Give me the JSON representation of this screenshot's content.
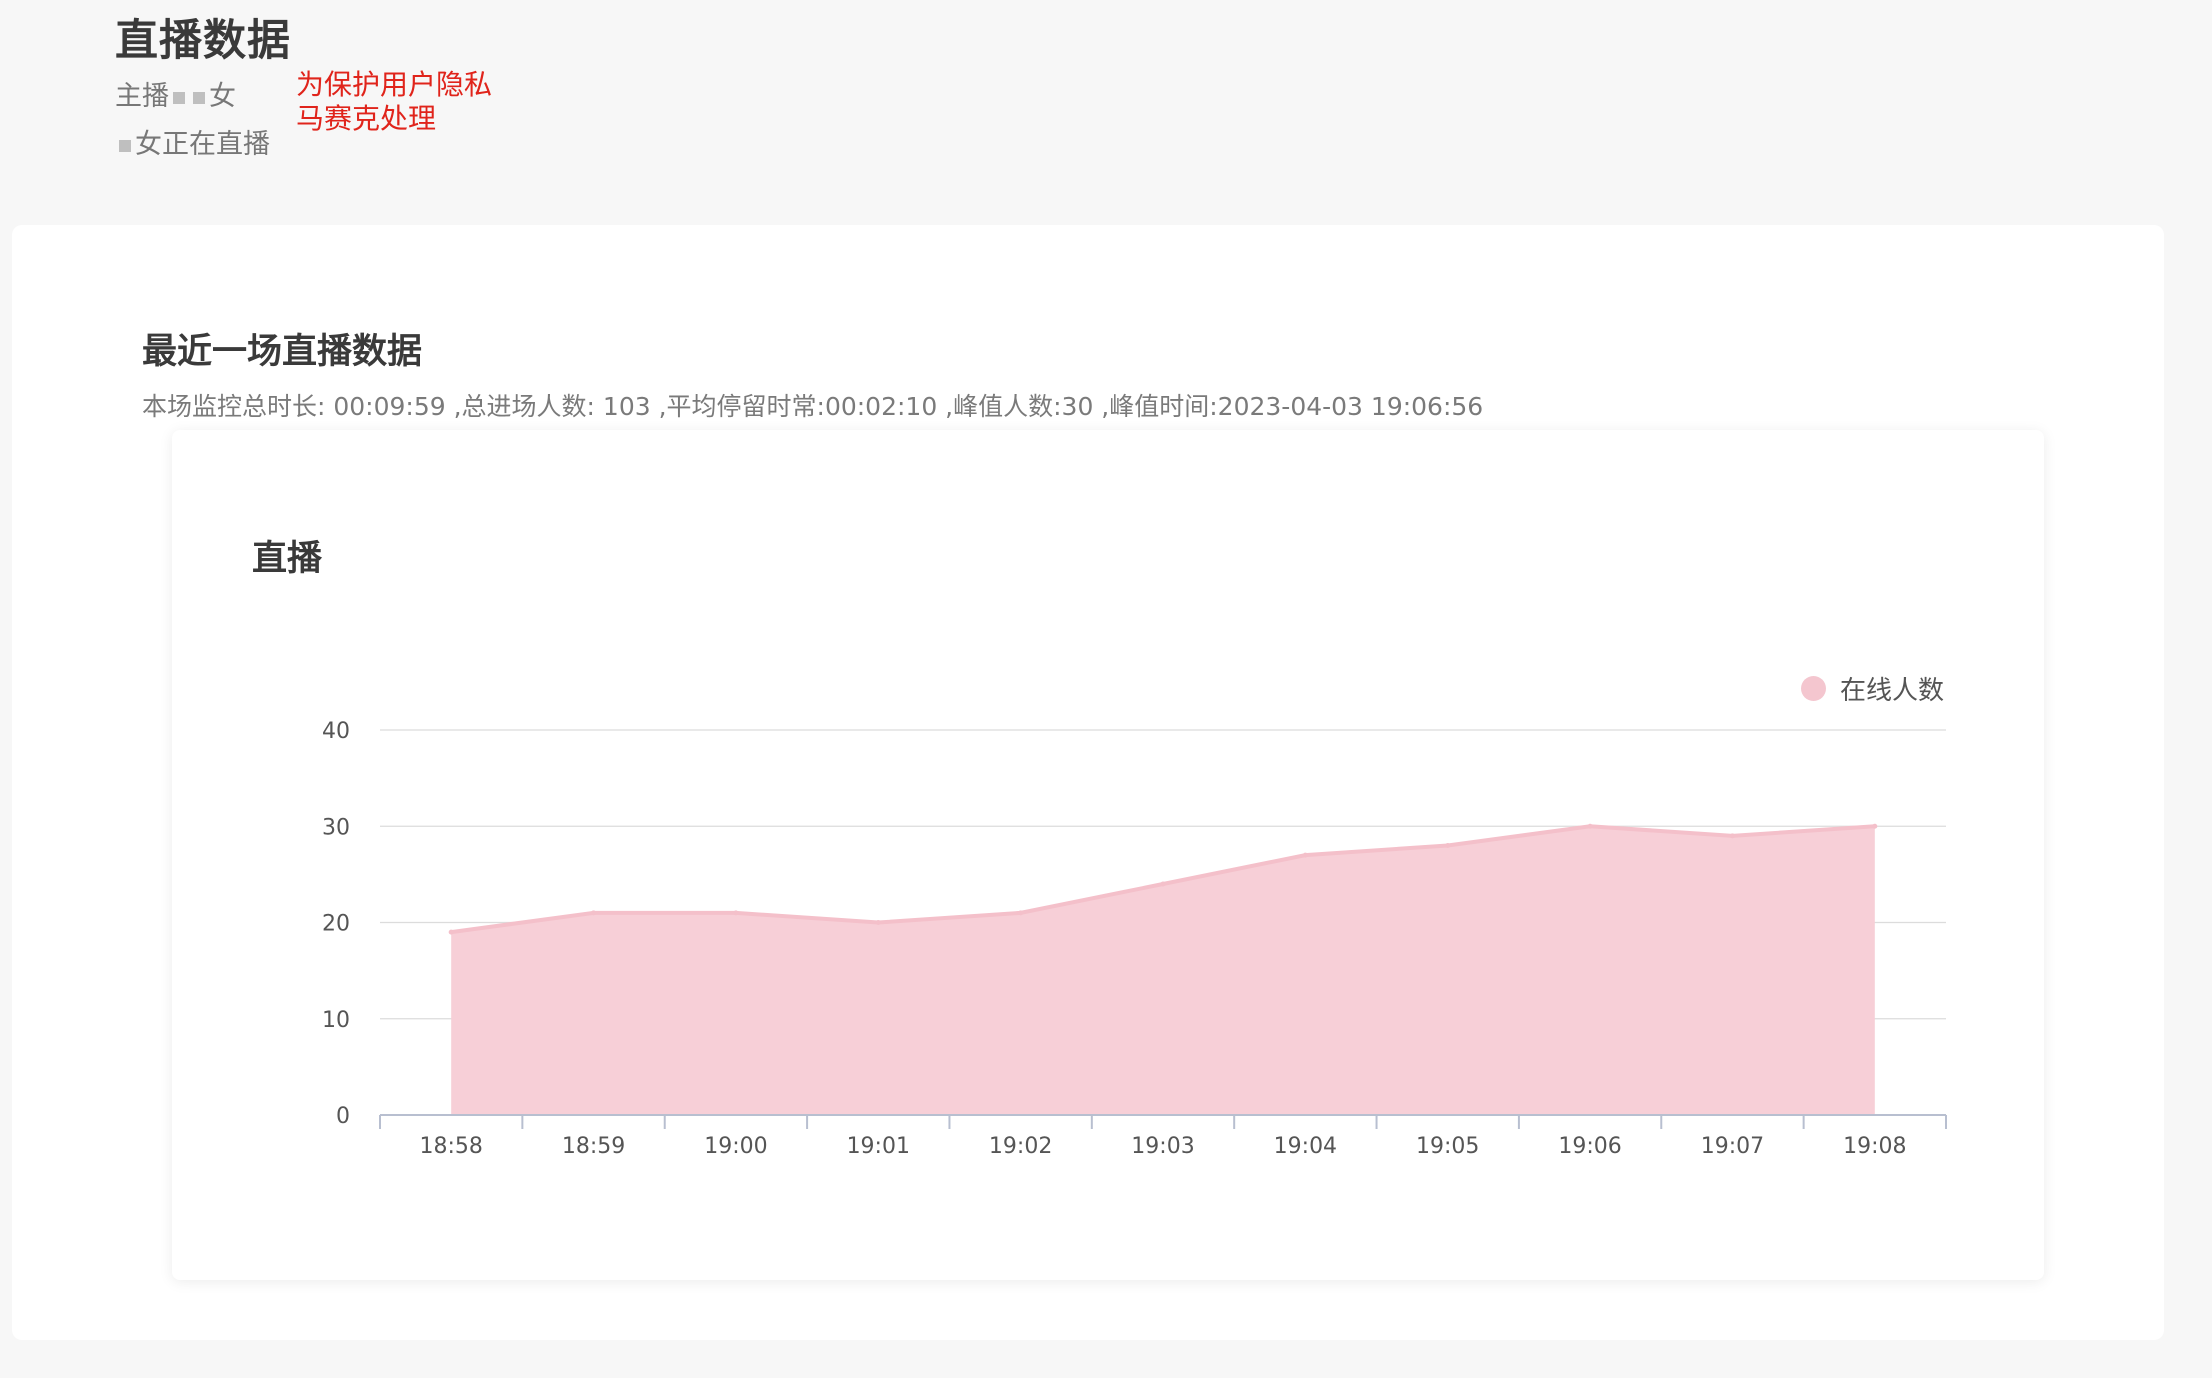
{
  "header": {
    "title": "直播数据",
    "anchor_prefix": "主播",
    "anchor_suffix": "女",
    "live_status_text": "女正在直播",
    "privacy_note_line1": "为保护用户隐私",
    "privacy_note_line2": "马赛克处理"
  },
  "section": {
    "title": "最近一场直播数据",
    "summary": "本场监控总时长: 00:09:59 ,总进场人数: 103 ,平均停留时常:00:02:10 ,峰值人数:30 ,峰值时间:2023-04-03 19:06:56"
  },
  "chart": {
    "title": "直播",
    "legend_label": "在线人数",
    "colors": {
      "fill": "#f7cfd7",
      "line": "#f4c0ca",
      "grid": "#dcdcdc",
      "axis": "#b8bfd0"
    }
  },
  "chart_data": {
    "type": "area",
    "title": "直播",
    "categories": [
      "18:58",
      "18:59",
      "19:00",
      "19:01",
      "19:02",
      "19:03",
      "19:04",
      "19:05",
      "19:06",
      "19:07",
      "19:08"
    ],
    "series": [
      {
        "name": "在线人数",
        "values": [
          19,
          21,
          21,
          20,
          21,
          24,
          27,
          28,
          30,
          29,
          30
        ]
      }
    ],
    "yticks": [
      0,
      10,
      20,
      30,
      40
    ],
    "ylim": [
      0,
      40
    ],
    "grid": true,
    "legend_position": "top-right"
  }
}
